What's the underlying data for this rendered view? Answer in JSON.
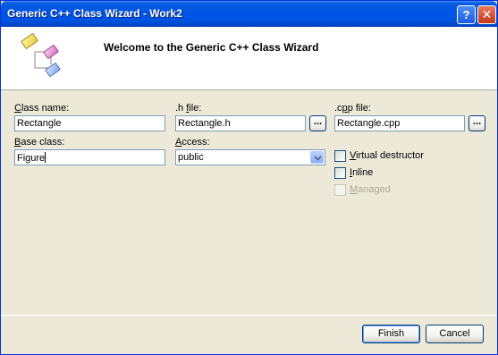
{
  "window": {
    "title": "Generic C++ Class Wizard - Work2",
    "help_glyph": "?",
    "close_glyph": "✕"
  },
  "header": {
    "title": "Welcome to the Generic C++ Class Wizard",
    "icon": "class-wizard-icon"
  },
  "form": {
    "class_name": {
      "label_accel": "C",
      "label_rest": "lass name:",
      "value": "Rectangle"
    },
    "h_file": {
      "label_pre": ".h ",
      "label_accel": "f",
      "label_rest": "ile:",
      "value": "Rectangle.h",
      "browse": "..."
    },
    "cpp_file": {
      "label_pre": ".c",
      "label_accel": "p",
      "label_rest": "p file:",
      "value": "Rectangle.cpp",
      "browse": "..."
    },
    "base_class": {
      "label_accel": "B",
      "label_rest": "ase class:",
      "value": "Figure"
    },
    "access": {
      "label_accel": "A",
      "label_rest": "ccess:",
      "value": "public"
    },
    "options": [
      {
        "accel": "V",
        "rest": "irtual destructor",
        "checked": false,
        "enabled": true
      },
      {
        "accel": "I",
        "rest": "nline",
        "checked": false,
        "enabled": true
      },
      {
        "accel": "M",
        "rest": "anaged",
        "checked": false,
        "enabled": false
      }
    ]
  },
  "buttons": {
    "finish": "Finish",
    "cancel": "Cancel"
  },
  "colors": {
    "titlebar": "#0054e3",
    "dialog_bg": "#ece9d8",
    "field_border": "#7f9db9"
  }
}
